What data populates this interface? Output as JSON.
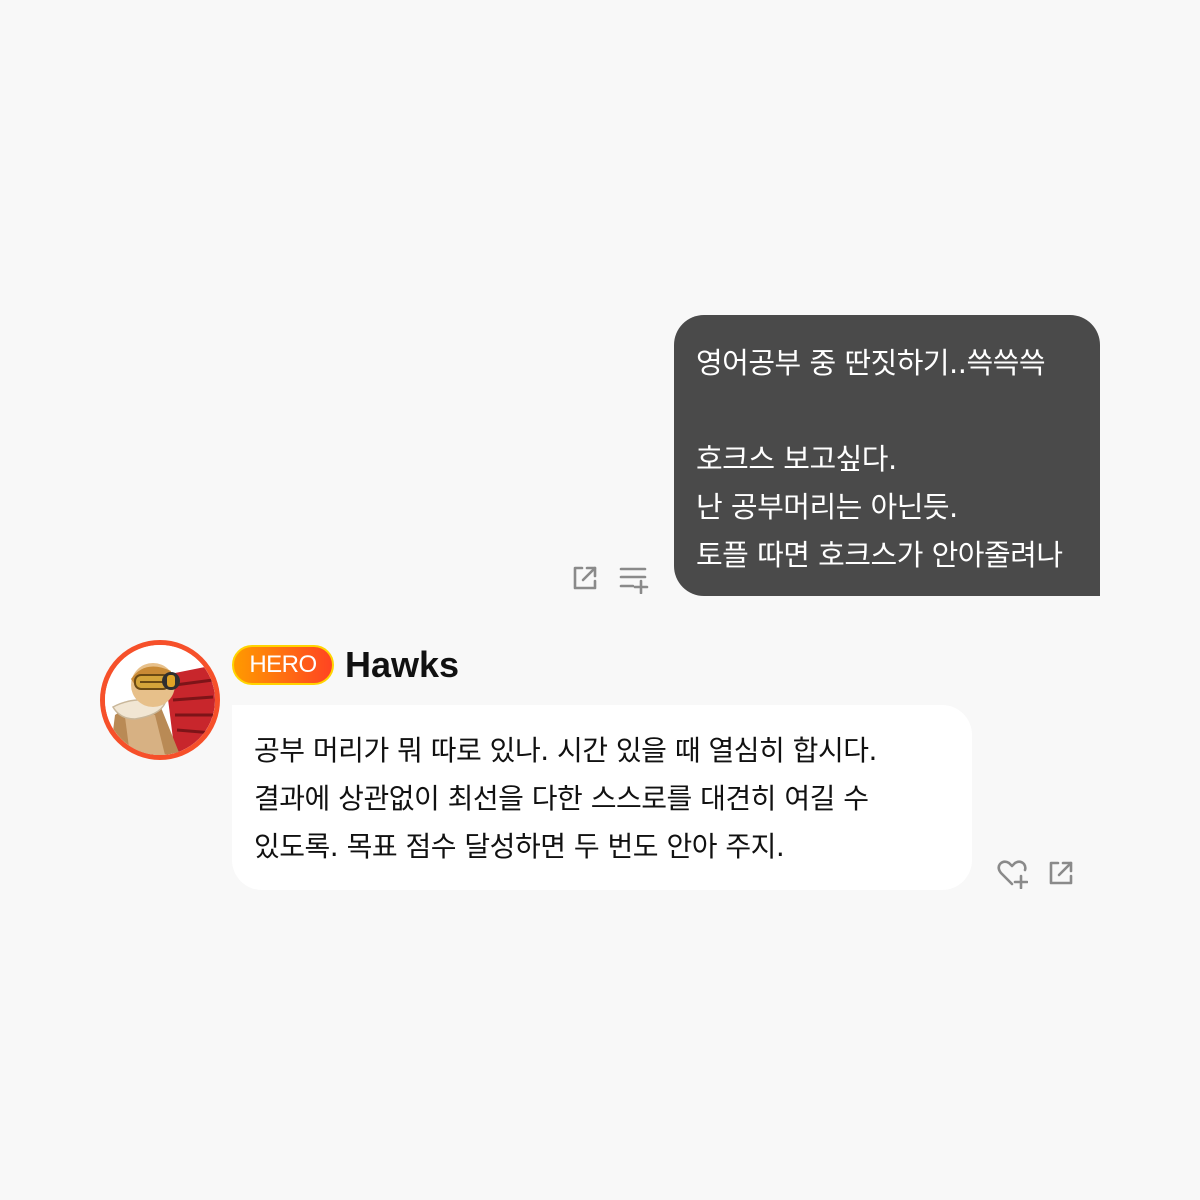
{
  "outgoing_message": {
    "lines": [
      "영어공부 중 딴짓하기..쓱쓱쓱",
      "",
      "호크스 보고싶다.",
      "난 공부머리는 아닌듯.",
      "토플 따면 호크스가 안아줄려나"
    ],
    "actions": [
      {
        "icon": "share-icon"
      },
      {
        "icon": "add-to-list-icon"
      }
    ],
    "bubble_color": "#4a4a4a"
  },
  "incoming_message": {
    "sender": {
      "badge": "HERO",
      "name": "Hawks",
      "avatar_icon": "hawks-avatar"
    },
    "lines": [
      "공부 머리가 뭐 따로 있나. 시간 있을 때 열심히 합시다.",
      "결과에 상관없이 최선을 다한 스스로를 대견히 여길 수",
      "있도록. 목표 점수 달성하면 두 번도 안아 주지."
    ],
    "actions": [
      {
        "icon": "heart-plus-icon"
      },
      {
        "icon": "share-icon"
      }
    ],
    "bubble_color": "#ffffff"
  },
  "colors": {
    "background": "#f8f8f8",
    "badge_gradient_start": "#ff9a00",
    "badge_gradient_end": "#ff4422",
    "avatar_ring": "#f6502a",
    "icon_gray": "#8a8a8a"
  }
}
